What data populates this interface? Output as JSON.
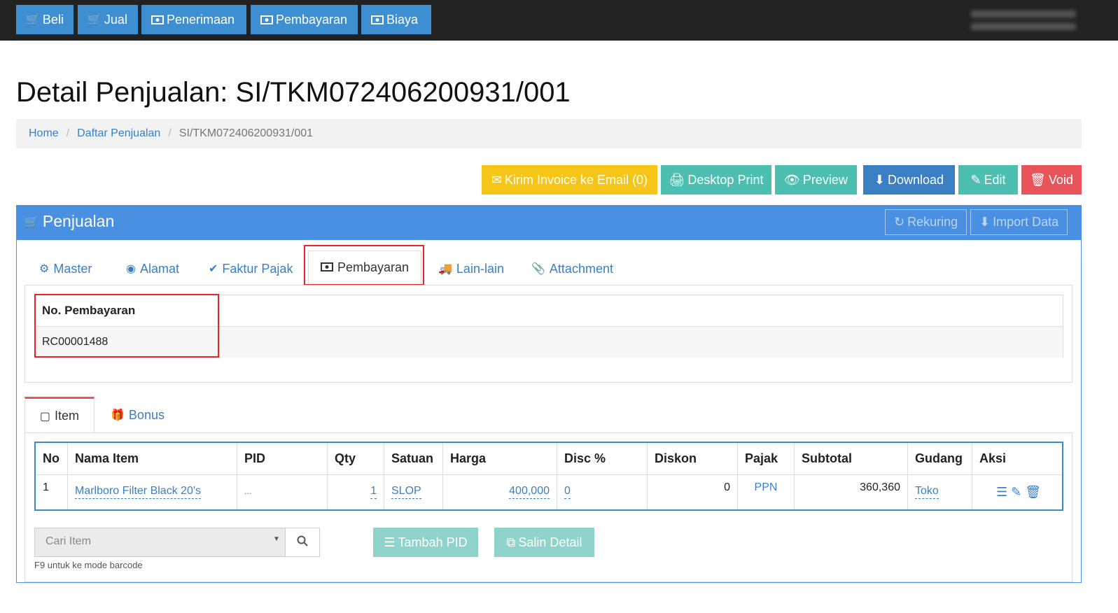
{
  "topnav": {
    "beli": "Beli",
    "jual": "Jual",
    "penerimaan": "Penerimaan",
    "pembayaran": "Pembayaran",
    "biaya": "Biaya"
  },
  "page": {
    "title": "Detail Penjualan: SI/TKM072406200931/001"
  },
  "breadcrumb": {
    "home": "Home",
    "list": "Daftar Penjualan",
    "current": "SI/TKM072406200931/001"
  },
  "actions": {
    "email": "Kirim Invoice ke Email (0)",
    "print": "Desktop Print",
    "preview": "Preview",
    "download": "Download",
    "edit": "Edit",
    "void": "Void"
  },
  "panel": {
    "title": "Penjualan",
    "rekuring": "Rekuring",
    "import": "Import Data"
  },
  "tabs": {
    "master": "Master",
    "alamat": "Alamat",
    "faktur": "Faktur Pajak",
    "pembayaran": "Pembayaran",
    "lain": "Lain-lain",
    "attachment": "Attachment"
  },
  "payment": {
    "header": "No. Pembayaran",
    "value": "RC00001488"
  },
  "itemtabs": {
    "item": "Item",
    "bonus": "Bonus"
  },
  "grid": {
    "headers": [
      "No",
      "Nama Item",
      "PID",
      "Qty",
      "Satuan",
      "Harga",
      "Disc %",
      "Diskon",
      "Pajak",
      "Subtotal",
      "Gudang",
      "Aksi"
    ],
    "row": {
      "no": "1",
      "nama": "Marlboro Filter Black 20's",
      "pid": "...",
      "qty": "1",
      "satuan": "SLOP",
      "harga": "400,000",
      "disc": "0",
      "diskon": "0",
      "pajak": "PPN",
      "subtotal": "360,360",
      "gudang": "Toko"
    }
  },
  "search": {
    "placeholder": "Cari Item",
    "hint": "F9 untuk ke mode barcode"
  },
  "buttons": {
    "tambah_pid": "Tambah PID",
    "salin": "Salin Detail"
  },
  "colors": {
    "topbar": "#222222",
    "primary": "#3d8fd1",
    "warning": "#f5c518",
    "teal": "#4cbfb0",
    "danger": "#e9545b",
    "highlight": "#e8232a"
  }
}
